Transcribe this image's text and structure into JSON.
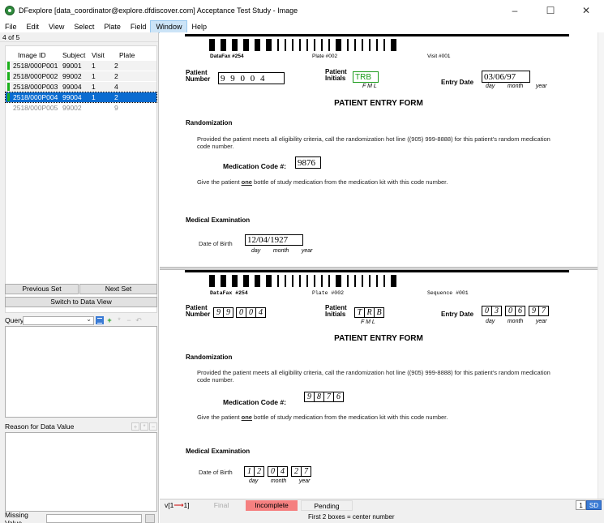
{
  "window": {
    "title": "DFexplore [data_coordinator@explore.dfdiscover.com] Acceptance Test Study - Image",
    "controls": [
      "–",
      "☐",
      "✕"
    ]
  },
  "menu": [
    "File",
    "Edit",
    "View",
    "Select",
    "Plate",
    "Field",
    "Window",
    "Help"
  ],
  "left": {
    "count": "4 of 5",
    "columns": [
      "Image ID",
      "Subject",
      "Visit",
      "Plate"
    ],
    "rows": [
      {
        "id": "2518/000P001",
        "subject": "99001",
        "visit": "1",
        "plate": "2"
      },
      {
        "id": "2518/000P002",
        "subject": "99002",
        "visit": "1",
        "plate": "2"
      },
      {
        "id": "2518/000P003",
        "subject": "99004",
        "visit": "1",
        "plate": "4"
      },
      {
        "id": "2518/000P004",
        "subject": "99004",
        "visit": "1",
        "plate": "2"
      },
      {
        "id": "2518/000P005",
        "subject": "99002",
        "visit": "",
        "plate": "9"
      }
    ],
    "previous_set": "Previous Set",
    "next_set": "Next Set",
    "switch_view": "Switch to Data View",
    "query_label": "Query",
    "reason_label": "Reason for Data Value",
    "missing_label": "Missing Value"
  },
  "form": {
    "datafax": "DataFax #254",
    "plate": "Plate #002",
    "visit": "Visit #001",
    "sequence": "Sequence #001",
    "patient_number_label": "Patient\nNumber",
    "patient_number": "9 9 0 0 4",
    "patient_number_digits": [
      "9",
      "9",
      "0",
      "0",
      "4"
    ],
    "patient_initials_label": "Patient\nInitials",
    "patient_initials": "TRB",
    "initials_digits": [
      "T",
      "R",
      "B"
    ],
    "initials_sub": "F   M   L",
    "entry_date_label": "Entry Date",
    "entry_date": "03/06/97",
    "entry_date_digits": [
      "0",
      "3",
      "0",
      "6",
      "9",
      "7"
    ],
    "date_sub": "day        month        year",
    "title": "PATIENT ENTRY FORM",
    "randomization": "Randomization",
    "random_text": "Provided the patient meets all eligibility criteria, call the randomization hot line ((905) 999-8888) for this patient's random medication code number.",
    "med_code_label": "Medication Code #:",
    "med_code": "9876",
    "med_code_digits": [
      "9",
      "8",
      "7",
      "6"
    ],
    "give_pre": "Give the patient ",
    "give_one": "one",
    "give_post": " bottle of study medication from the medication kit with this code number.",
    "med_exam": "Medical Examination",
    "dob_label": "Date of Birth",
    "dob": "12/04/1927",
    "dob_digits": [
      "1",
      "2",
      "0",
      "4",
      "2",
      "7"
    ],
    "dob_sub": "day        month        year"
  },
  "status": {
    "version": "v[1",
    "version_tail": "1]",
    "final": "Final",
    "incomplete": "Incomplete",
    "pending": "Pending",
    "zoom_a": "1",
    "zoom_b": "SD",
    "hint": "First 2 boxes = center number"
  },
  "colors": {
    "accent": "#0a6bd0",
    "status_green": "#1bb01b",
    "incomplete": "#f58080",
    "field_green": "#1a9b1a"
  }
}
